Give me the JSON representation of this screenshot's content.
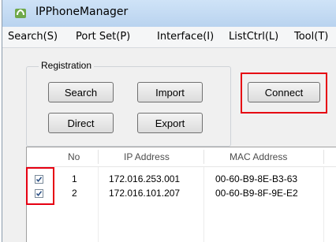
{
  "window": {
    "title": "IPPhoneManager"
  },
  "menu": [
    {
      "label": "Search(S)"
    },
    {
      "label": "Port Set(P)"
    },
    {
      "label": "Interface(I)"
    },
    {
      "label": "ListCtrl(L)"
    },
    {
      "label": "Tool(T)"
    }
  ],
  "registration": {
    "label": "Registration",
    "search": "Search",
    "import": "Import",
    "direct": "Direct",
    "export": "Export"
  },
  "connect": "Connect",
  "table": {
    "headers": {
      "no": "No",
      "ip": "IP Address",
      "mac": "MAC Address"
    },
    "rows": [
      {
        "checked": true,
        "no": "1",
        "ip": "172.016.253.001",
        "mac": "00-60-B9-8E-B3-63"
      },
      {
        "checked": true,
        "no": "2",
        "ip": "172.016.101.207",
        "mac": "00-60-B9-8F-9E-E2"
      }
    ]
  },
  "colors": {
    "highlight": "#e60012",
    "titlebar": "#c4dbf3"
  }
}
